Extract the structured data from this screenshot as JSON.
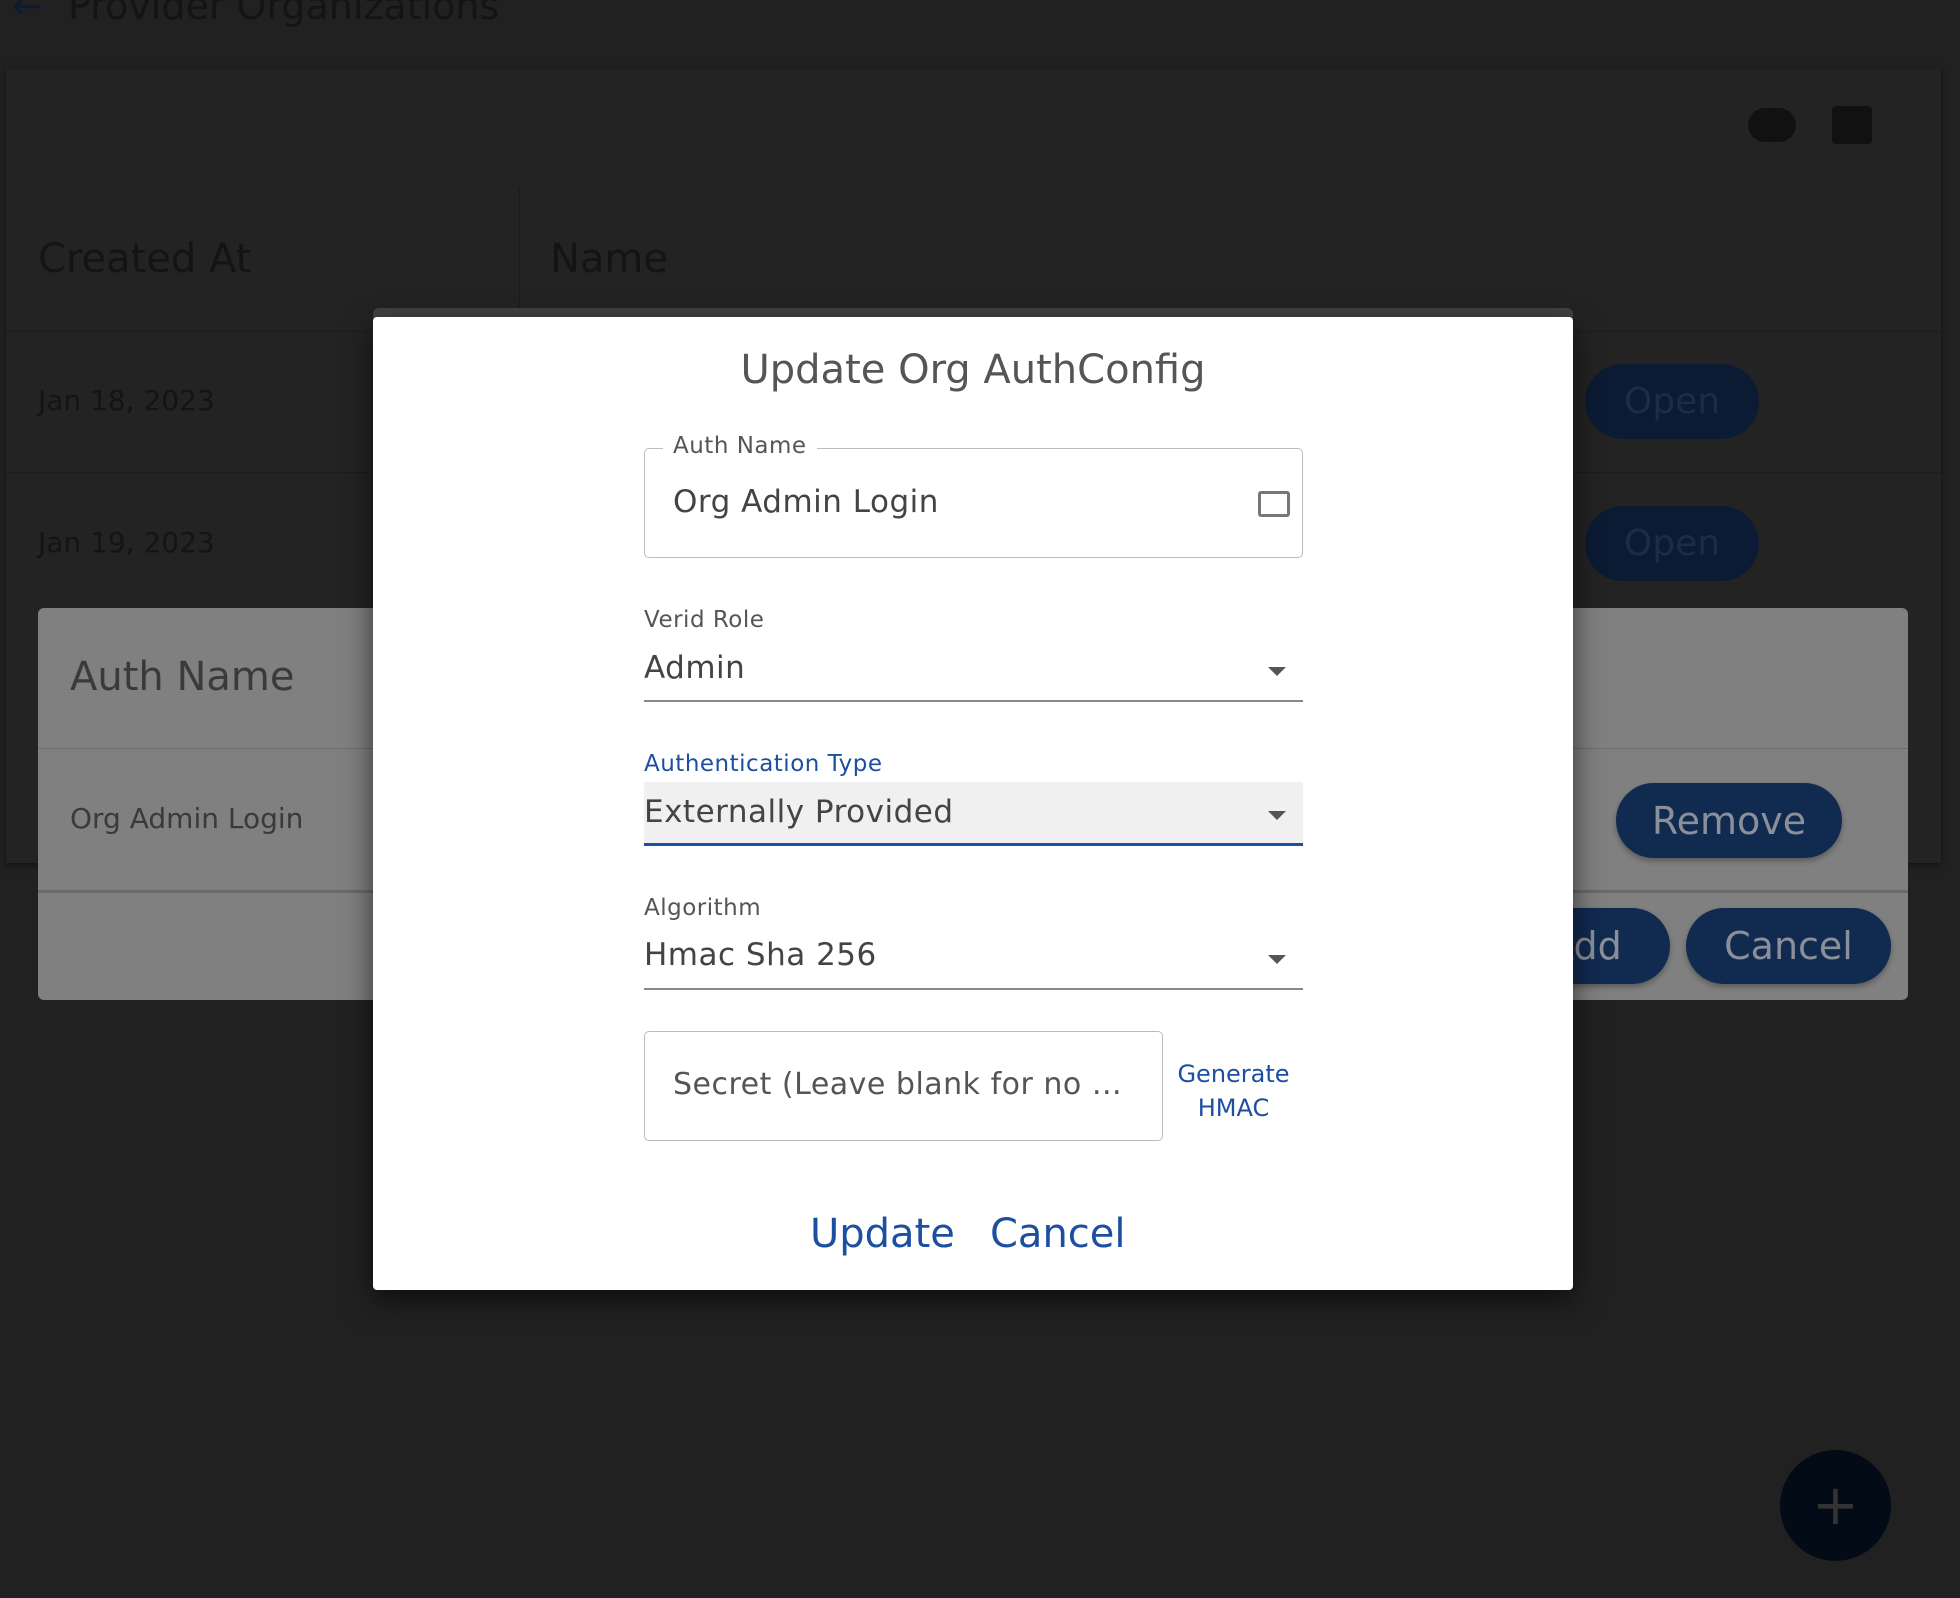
{
  "header": {
    "title": "Provider Organizations"
  },
  "table": {
    "columns": [
      "Created At",
      "Name"
    ],
    "rows": [
      {
        "created_at": "Jan 18, 2023",
        "action": "Open"
      },
      {
        "created_at": "Jan 19, 2023",
        "action": "Open"
      }
    ]
  },
  "auth_panel": {
    "column": "Auth Name",
    "rows": [
      {
        "name": "Org Admin Login",
        "action": "Remove"
      }
    ],
    "add_label": "Add",
    "cancel_label": "Cancel"
  },
  "fab": {
    "label": "+"
  },
  "dialog": {
    "title": "Update Org AuthConfig",
    "auth_name": {
      "label": "Auth Name",
      "value": "Org Admin Login"
    },
    "verid_role": {
      "label": "Verid Role",
      "value": "Admin"
    },
    "auth_type": {
      "label": "Authentication Type",
      "value": "Externally Provided"
    },
    "algorithm": {
      "label": "Algorithm",
      "value": "Hmac Sha 256"
    },
    "secret": {
      "placeholder": "Secret (Leave blank for no …"
    },
    "generate": {
      "line1": "Generate",
      "line2": "HMAC"
    },
    "update_label": "Update",
    "cancel_label": "Cancel"
  },
  "colors": {
    "accent": "#1c4fa0",
    "button": "#112a50",
    "overlay": "#212121"
  }
}
